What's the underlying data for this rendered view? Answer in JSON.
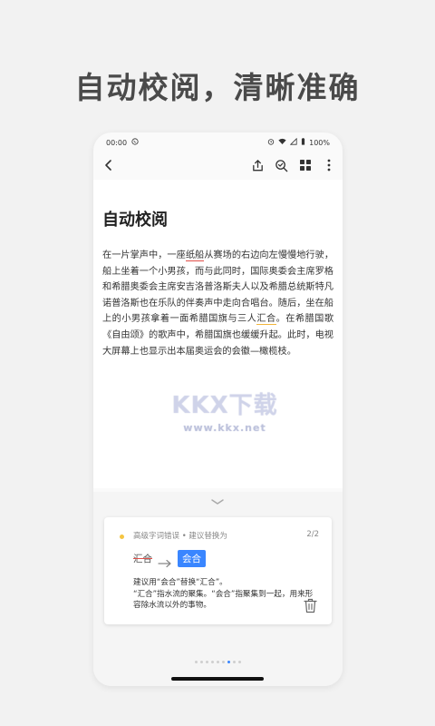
{
  "promo": {
    "headline": "自动校阅，清晰准确"
  },
  "status_bar": {
    "time": "00:00",
    "battery": "100%"
  },
  "document": {
    "title": "自动校阅",
    "paragraph": [
      {
        "t": "在一片掌声中，一座"
      },
      {
        "t": "纸船",
        "mark": "red"
      },
      {
        "t": "从赛场的右边向左慢慢地行驶，船上坐着一个小男孩，而与此同时，国际奥委会主席罗格和希腊奥委会主席安吉洛普洛斯夫人以及希腊总统斯特凡诺普洛斯也在乐队的伴奏声中走向合唱台。随后，坐在船上的小男孩拿着一面希腊国旗与三人"
      },
      {
        "t": "汇合",
        "mark": "orange"
      },
      {
        "t": "。在希腊国歌《自由颂》的歌声中，希腊国旗也缓缓升起。此时，电视大屏幕上也显示出本届奥运会的会徽—橄榄枝。"
      }
    ]
  },
  "watermark": {
    "logo": "KKX下载",
    "url": "www.kkx.net"
  },
  "review_card": {
    "type_label": "高级字词错误 • 建议替换为",
    "count": "2/2",
    "original_word": "汇合",
    "suggested_word": "会合",
    "explanation": [
      "建议用“会合”替换“汇合”。",
      "“汇合”指水流的聚集。“会合”指聚集到一起，用来形容除水流以外的事物。"
    ]
  },
  "pager": {
    "total": 9,
    "active": 6
  },
  "colors": {
    "accent": "#3a86ff",
    "error_red": "#e0504a",
    "warning_orange": "#f2b53a",
    "dot_yellow": "#f5c542"
  },
  "icons": {
    "back": "chevron-left-icon",
    "share": "share-icon",
    "proofread": "search-check-icon",
    "grid": "grid-icon",
    "more": "more-vertical-icon",
    "collapse": "chevron-down-icon",
    "arrow": "arrow-right-icon",
    "delete": "trash-icon"
  }
}
